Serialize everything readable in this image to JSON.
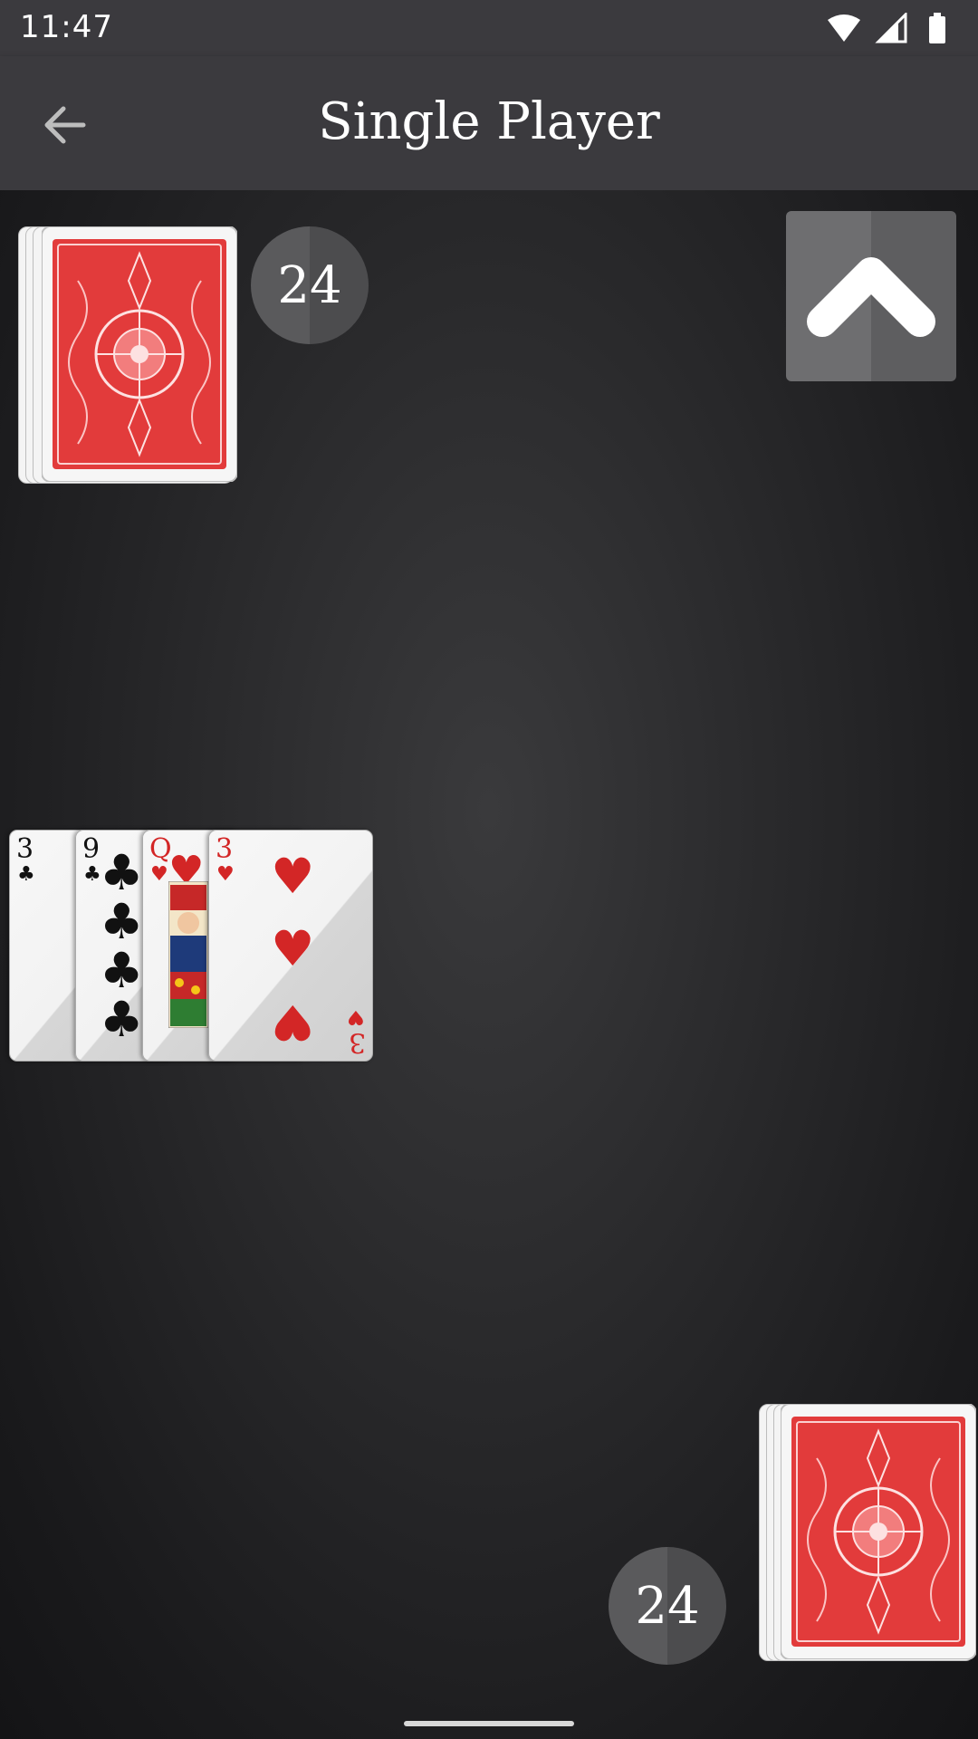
{
  "status_bar": {
    "time": "11:47"
  },
  "app_bar": {
    "title": "Single Player"
  },
  "opponent": {
    "card_count": "24"
  },
  "player": {
    "card_count": "24"
  },
  "pile": [
    {
      "rank": "3",
      "suit": "♣",
      "color": "black"
    },
    {
      "rank": "9",
      "suit": "♣",
      "color": "black"
    },
    {
      "rank": "Q",
      "suit": "♥",
      "color": "red"
    },
    {
      "rank": "3",
      "suit": "♥",
      "color": "red"
    }
  ],
  "colors": {
    "bar": "#3b3a3e",
    "table": "#2a2a2c",
    "card_back_red": "#e23b3b",
    "heart_red": "#d32626"
  }
}
